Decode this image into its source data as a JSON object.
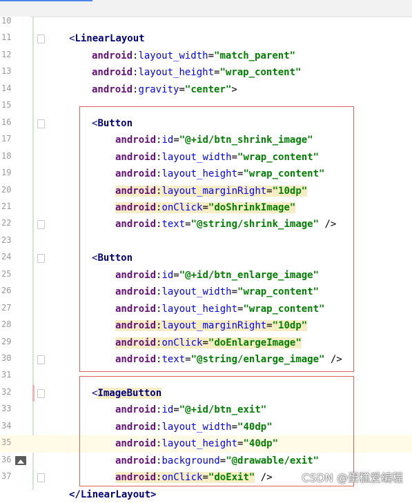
{
  "editor": {
    "lines": [
      {
        "num": "10"
      },
      {
        "num": "11"
      },
      {
        "num": "12"
      },
      {
        "num": "13"
      },
      {
        "num": "14"
      },
      {
        "num": "15"
      },
      {
        "num": "16"
      },
      {
        "num": "17"
      },
      {
        "num": "18"
      },
      {
        "num": "19"
      },
      {
        "num": "20"
      },
      {
        "num": "21"
      },
      {
        "num": "22"
      },
      {
        "num": "23"
      },
      {
        "num": "24"
      },
      {
        "num": "25"
      },
      {
        "num": "26"
      },
      {
        "num": "27"
      },
      {
        "num": "28"
      },
      {
        "num": "29"
      },
      {
        "num": "30"
      },
      {
        "num": "31"
      },
      {
        "num": "32"
      },
      {
        "num": "33"
      },
      {
        "num": "34"
      },
      {
        "num": "35"
      },
      {
        "num": "36"
      },
      {
        "num": "37"
      }
    ],
    "tokens": {
      "lt": "<",
      "gt": ">",
      "selfclose": " />",
      "eq": "=",
      "colon": ":",
      "linearlayout": "LinearLayout",
      "button": "Button",
      "imagebutton": "ImageButton",
      "android": "android",
      "layout_width": "layout_width",
      "layout_height": "layout_height",
      "gravity": "gravity",
      "id": "id",
      "layout_marginRight": "layout_marginRight",
      "onClick": "onClick",
      "text": "text",
      "background": "background",
      "v_match_parent": "\"match_parent\"",
      "v_wrap_content": "\"wrap_content\"",
      "v_center": "\"center\"",
      "v_btn_shrink": "\"@+id/btn_shrink_image\"",
      "v_10dp": "\"10dp\"",
      "v_doShrink": "\"doShrinkImage\"",
      "v_str_shrink": "\"@string/shrink_image\"",
      "v_btn_enlarge": "\"@+id/btn_enlarge_image\"",
      "v_doEnlarge": "\"doEnlargeImage\"",
      "v_str_enlarge": "\"@string/enlarge_image\"",
      "v_btn_exit": "\"@+id/btn_exit\"",
      "v_40dp": "\"40dp\"",
      "v_drawable_exit": "\"@drawable/exit\"",
      "v_doExit": "\"doExit\"",
      "last_partial": "</LinearLayout>"
    }
  },
  "watermark": "CSDN @蛋糕爱编程",
  "colors": {
    "tag": "#000080",
    "namespace": "#660e7a",
    "attribute": "#0000ff",
    "value": "#008000",
    "highlight": "#f7edc4",
    "box": "#e06060"
  }
}
